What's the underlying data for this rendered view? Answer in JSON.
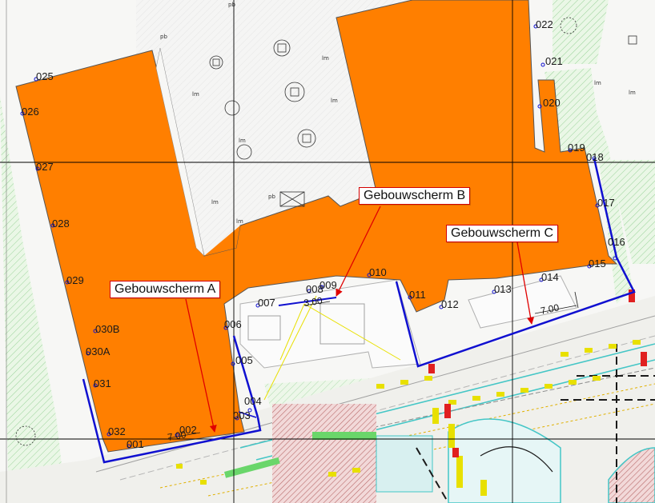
{
  "colors": {
    "building": "#ff7f00",
    "screen_line": "#1010d0",
    "callout_border": "#d40000",
    "arrow": "#e00000",
    "green_hatch": "#8fd18f",
    "paving": "#c98a8a",
    "road_marking": "#f2e600",
    "grid": "#000000",
    "cyan_line": "#44c6c6"
  },
  "callouts": [
    {
      "id": "a",
      "label": "Gebouwscherm A"
    },
    {
      "id": "b",
      "label": "Gebouwscherm B"
    },
    {
      "id": "c",
      "label": "Gebouwscherm C"
    }
  ],
  "dimensions": {
    "d1": "7.00",
    "d2": "3.00",
    "d3": "7.00"
  },
  "points": [
    {
      "id": "p001",
      "label": "001"
    },
    {
      "id": "p002",
      "label": "002"
    },
    {
      "id": "p003",
      "label": "003"
    },
    {
      "id": "p004",
      "label": "004"
    },
    {
      "id": "p005",
      "label": "005"
    },
    {
      "id": "p006",
      "label": "006"
    },
    {
      "id": "p007",
      "label": "007"
    },
    {
      "id": "p008",
      "label": "008"
    },
    {
      "id": "p009",
      "label": "009"
    },
    {
      "id": "p010",
      "label": "010"
    },
    {
      "id": "p011",
      "label": "011"
    },
    {
      "id": "p012",
      "label": "012"
    },
    {
      "id": "p013",
      "label": "013"
    },
    {
      "id": "p014",
      "label": "014"
    },
    {
      "id": "p015",
      "label": "015"
    },
    {
      "id": "p016",
      "label": "016"
    },
    {
      "id": "p017",
      "label": "017"
    },
    {
      "id": "p018",
      "label": "018"
    },
    {
      "id": "p019",
      "label": "019"
    },
    {
      "id": "p020",
      "label": "020"
    },
    {
      "id": "p021",
      "label": "021"
    },
    {
      "id": "p022",
      "label": "022"
    },
    {
      "id": "p025",
      "label": "025"
    },
    {
      "id": "p026",
      "label": "026"
    },
    {
      "id": "p027",
      "label": "027"
    },
    {
      "id": "p028",
      "label": "028"
    },
    {
      "id": "p029",
      "label": "029"
    },
    {
      "id": "p030B",
      "label": "030B"
    },
    {
      "id": "p030A",
      "label": "030A"
    },
    {
      "id": "p031",
      "label": "031"
    },
    {
      "id": "p032",
      "label": "032"
    }
  ]
}
